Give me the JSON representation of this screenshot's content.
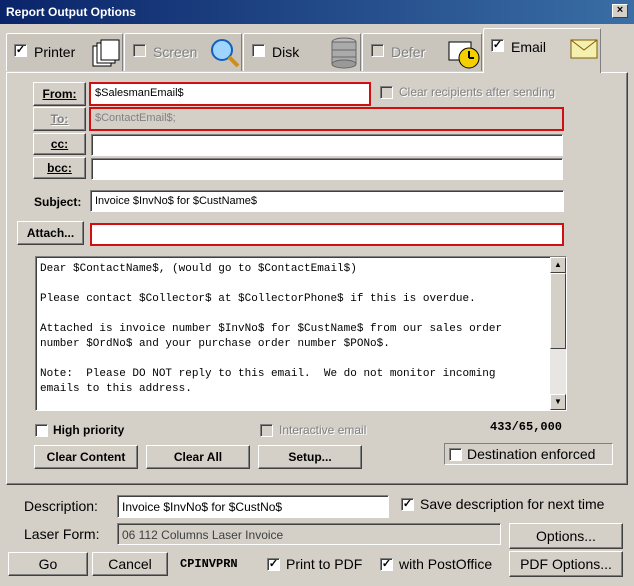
{
  "window": {
    "title": "Report Output Options",
    "close_glyph": "×"
  },
  "tabs": [
    {
      "label": "Printer",
      "checked": "✓",
      "icon": "printer-pages-icon"
    },
    {
      "label": "Screen",
      "checked": "",
      "icon": "magnifier-icon"
    },
    {
      "label": "Disk",
      "checked": "",
      "icon": "database-icon"
    },
    {
      "label": "Defer",
      "checked": "",
      "icon": "clock-icon"
    },
    {
      "label": "Email",
      "checked": "✓",
      "icon": "envelope-icon"
    }
  ],
  "email": {
    "from_label": "From:",
    "from_value": "$SalesmanEmail$",
    "clear_recipients_label": "Clear recipients after sending",
    "to_label": "To:",
    "to_value": "$ContactEmail$;",
    "cc_label": "cc:",
    "cc_value": "",
    "bcc_label": "bcc:",
    "bcc_value": "",
    "subject_label": "Subject:",
    "subject_value": "Invoice $InvNo$ for $CustName$",
    "attach_label": "Attach...",
    "attach_value": "",
    "body": "Dear $ContactName$, (would go to $ContactEmail$)\n\nPlease contact $Collector$ at $CollectorPhone$ if this is overdue.\n\nAttached is invoice number $InvNo$ for $CustName$ from our sales order\nnumber $OrdNo$ and your purchase order number $PONo$.\n\nNote:  Please DO NOT reply to this email.  We do not monitor incoming\nemails to this address.",
    "high_priority_label": "High priority",
    "interactive_email_label": "Interactive email",
    "char_count": "433/65,000",
    "clear_content_label": "Clear Content",
    "clear_all_label": "Clear All",
    "setup_label": "Setup...",
    "destination_enforced_label": "Destination enforced"
  },
  "bottom": {
    "description_label": "Description:",
    "description_value": "Invoice $InvNo$ for $CustNo$",
    "save_description_label": "Save description for next time",
    "save_description_checked": "✓",
    "laser_form_label": "Laser Form:",
    "laser_form_value": "06 112 Columns Laser Invoice",
    "options_label": "Options...",
    "go_label": "Go",
    "cancel_label": "Cancel",
    "report_code": "CPINVPRN",
    "print_pdf_label": "Print to PDF",
    "print_pdf_checked": "✓",
    "postoffice_label": "with PostOffice",
    "postoffice_checked": "✓",
    "pdf_options_label": "PDF Options..."
  }
}
